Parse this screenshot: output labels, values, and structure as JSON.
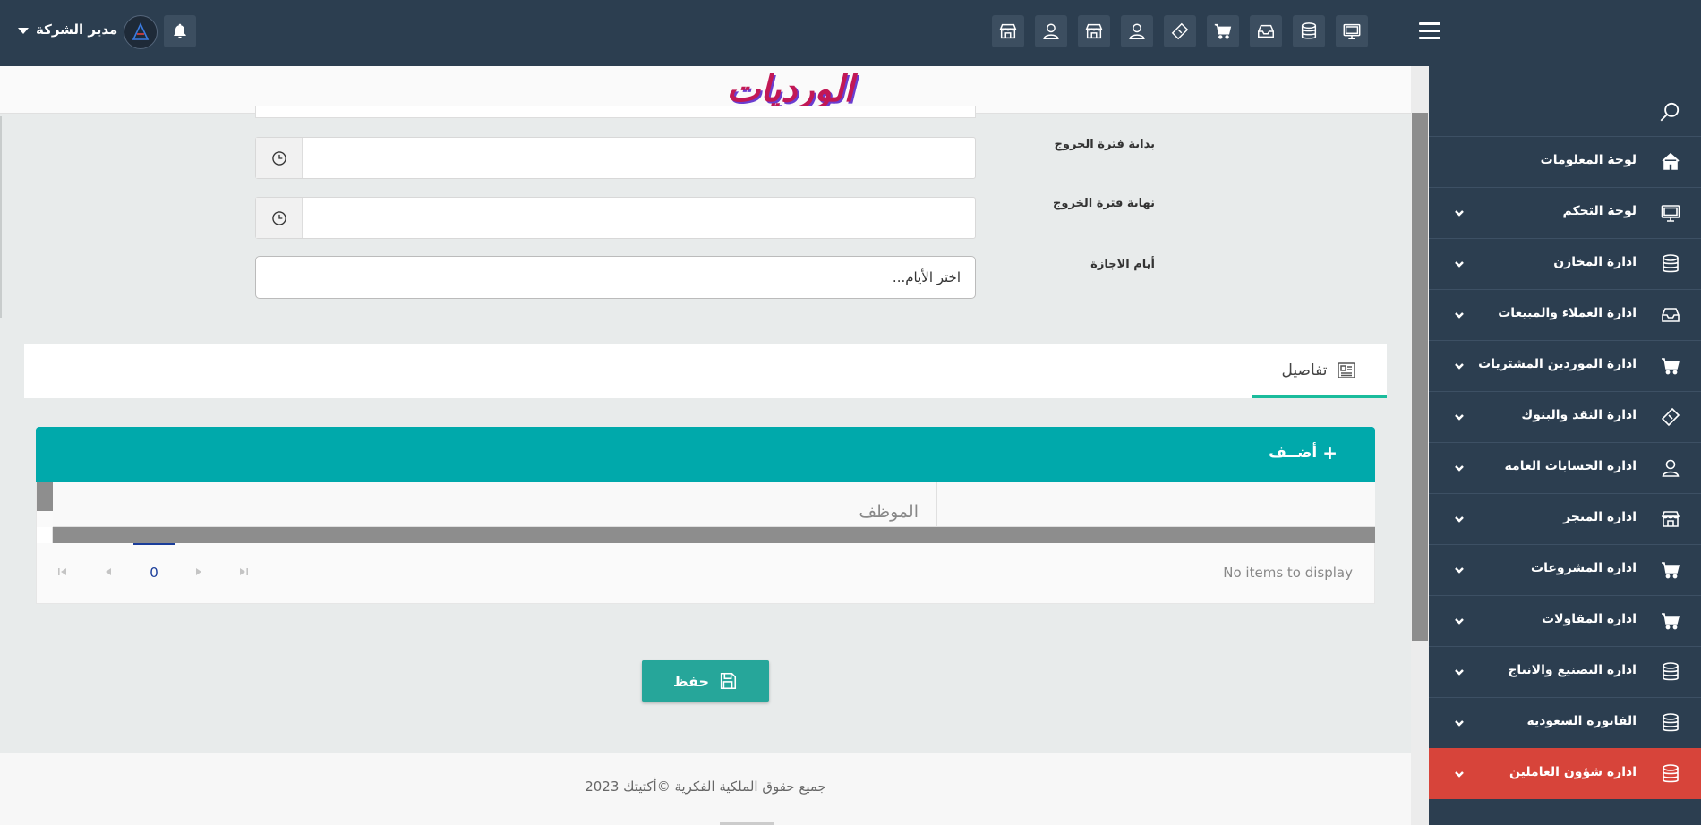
{
  "header": {
    "user_name": "مدير الشركة",
    "toolbar_icons": [
      "monitor-icon",
      "database-icon",
      "inbox-icon",
      "cart-icon",
      "ticket-icon",
      "user-icon",
      "store-icon",
      "user-icon",
      "store-icon"
    ]
  },
  "page": {
    "title": "الورديات"
  },
  "form": {
    "exit_start_label": "بداية فترة الخروج",
    "exit_end_label": "نهاية فترة الخروج",
    "vacation_days_label": "أيام الاجازة",
    "vacation_days_placeholder": "اختر الأيام..."
  },
  "tabs": {
    "details_label": "تفاصيل"
  },
  "grid": {
    "add_label": "أضــف",
    "column_employee": "الموظف",
    "page_number": "0",
    "empty_message": "No items to display"
  },
  "actions": {
    "save_label": "حفظ"
  },
  "footer": {
    "copyright": "جميع حقوق الملكية الفكرية ©أكتيتك 2023"
  },
  "sidebar": {
    "items": [
      {
        "label": "لوحة المعلومات",
        "icon": "home-icon",
        "has_submenu": false
      },
      {
        "label": "لوحة التحكم",
        "icon": "monitor-icon",
        "has_submenu": true
      },
      {
        "label": "ادارة المخازن",
        "icon": "database-icon",
        "has_submenu": true
      },
      {
        "label": "ادارة العملاء والمبيعات",
        "icon": "inbox-icon",
        "has_submenu": true
      },
      {
        "label": "ادارة الموردين المشتريات",
        "icon": "cart-icon",
        "has_submenu": true
      },
      {
        "label": "ادارة النقد والبنوك",
        "icon": "ticket-icon",
        "has_submenu": true
      },
      {
        "label": "ادارة الحسابات العامة",
        "icon": "user-icon",
        "has_submenu": true
      },
      {
        "label": "ادارة المتجر",
        "icon": "store-icon",
        "has_submenu": true
      },
      {
        "label": "ادارة المشروعات",
        "icon": "cart-icon",
        "has_submenu": true
      },
      {
        "label": "ادارة المقاولات",
        "icon": "cart-icon",
        "has_submenu": true
      },
      {
        "label": "ادارة التصنيع والانتاج",
        "icon": "database-icon",
        "has_submenu": true
      },
      {
        "label": "الفاتورة السعودية",
        "icon": "database-icon",
        "has_submenu": true
      },
      {
        "label": "ادارة شؤون العاملين",
        "icon": "database-icon",
        "has_submenu": true,
        "active": true
      }
    ]
  },
  "colors": {
    "topbar": "#2c3e50",
    "active_menu": "#d7443a",
    "grid_header_bar": "#00a9ab",
    "save_button": "#26a69a",
    "tab_underline": "#1abc9c"
  }
}
